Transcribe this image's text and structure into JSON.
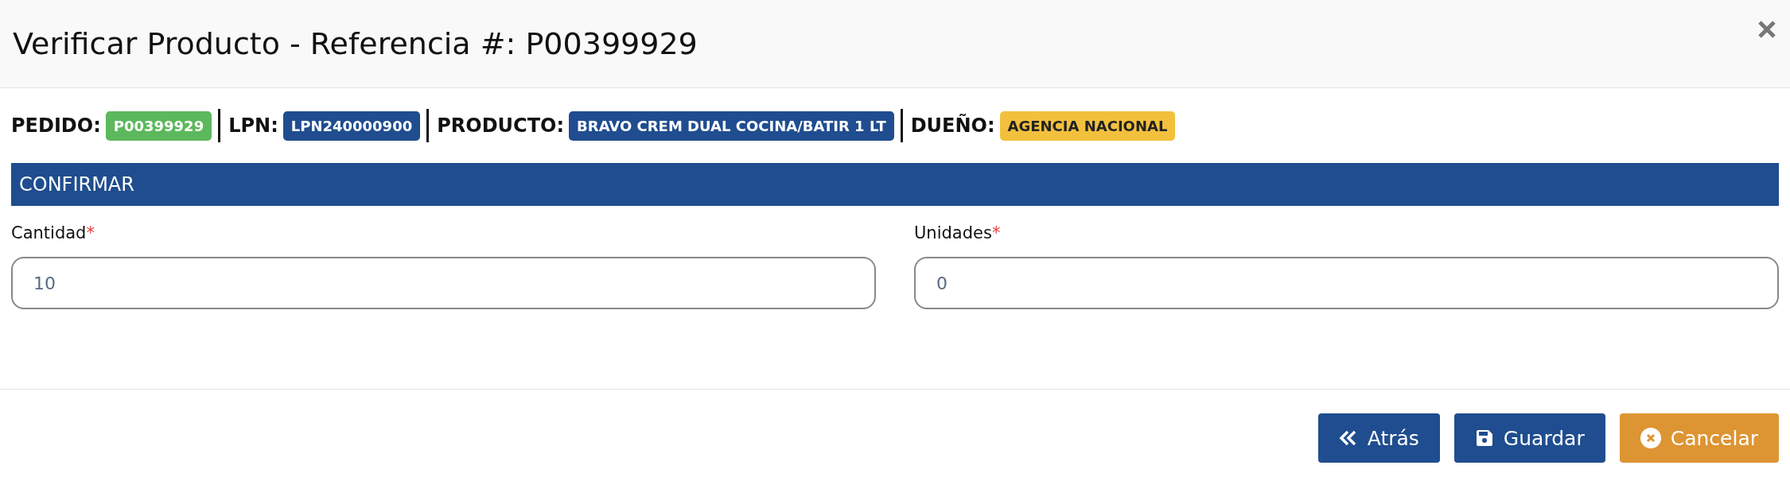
{
  "modal": {
    "title": "Verificar Producto - Referencia #: P00399929"
  },
  "info": [
    {
      "label": "PEDIDO:",
      "value": "P00399929",
      "color": "#5cb85c"
    },
    {
      "label": "LPN:",
      "value": "LPN240000900",
      "color": "#1f4d8f"
    },
    {
      "label": "PRODUCTO:",
      "value": "BRAVO CREM DUAL COCINA/BATIR 1 LT",
      "color": "#1f4d8f"
    },
    {
      "label": "DUEÑO:",
      "value": "AGENCIA NACIONAL",
      "color": "#f2c03d"
    }
  ],
  "section": {
    "title": "CONFIRMAR"
  },
  "fields": [
    {
      "label": "Cantidad",
      "required_mark": "*",
      "value": "10"
    },
    {
      "label": "Unidades",
      "required_mark": "*",
      "value": "0"
    }
  ],
  "buttons": [
    {
      "kind": "back",
      "label": "Atrás"
    },
    {
      "kind": "save",
      "label": "Guardar"
    },
    {
      "kind": "cancel",
      "label": "Cancelar"
    }
  ]
}
